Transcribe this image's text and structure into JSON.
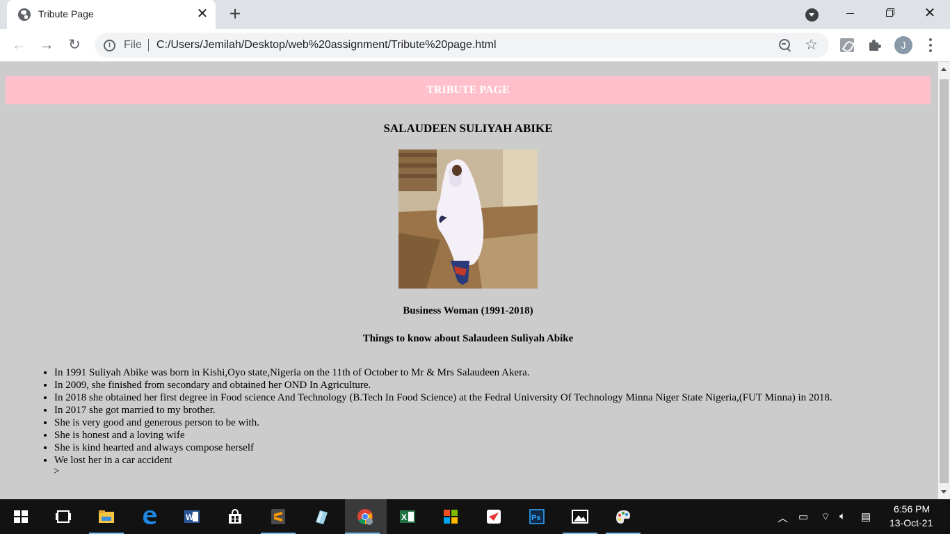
{
  "browser": {
    "tab_title": "Tribute Page",
    "tab_close": "✕",
    "new_tab": "+",
    "scheme_label": "File",
    "url": "C:/Users/Jemilah/Desktop/web%20assignment/Tribute%20page.html",
    "avatar_letter": "J",
    "icons": [
      "globe-icon",
      "back-icon",
      "forward-icon",
      "reload-icon",
      "info-icon",
      "zoom-icon",
      "star-icon",
      "pdf-extension-icon",
      "extensions-icon",
      "menu-icon"
    ]
  },
  "page": {
    "banner": "TRIBUTE PAGE",
    "name": "SALAUDEEN SULIYAH ABIKE",
    "photo_caption": "Business Woman (1991-2018)",
    "subheading": "Things to know about Salaudeen Suliyah Abike",
    "facts": [
      "In 1991 Suliyah Abike was born in Kishi,Oyo state,Nigeria on the 11th of October to Mr & Mrs Salaudeen Akera.",
      "In 2009, she finished from secondary and obtained her OND In Agriculture.",
      "In 2018 she obtained her first degree in Food science And Technology (B.Tech In Food Science) at the Fedral University Of Technology Minna Niger State Nigeria,(FUT Minna) in 2018.",
      "In 2017 she got married to my brother.",
      "She is very good and generous person to be with.",
      "She is honest and a loving wife",
      "She is kind hearted and always compose herself",
      "We lost her in a car accident"
    ],
    "stray_text": ">",
    "colors": {
      "banner_bg": "#ffc0cb",
      "page_bg": "#cccccc",
      "banner_text": "#ffffff"
    }
  },
  "taskbar": {
    "time": "6:56 PM",
    "date": "13-Oct-21",
    "apps": [
      "windows-start",
      "task-view",
      "file-explorer",
      "edge",
      "word",
      "store",
      "sublime-text",
      "notepad",
      "chrome",
      "excel",
      "office",
      "app-red",
      "photoshop",
      "photos",
      "paint"
    ]
  }
}
